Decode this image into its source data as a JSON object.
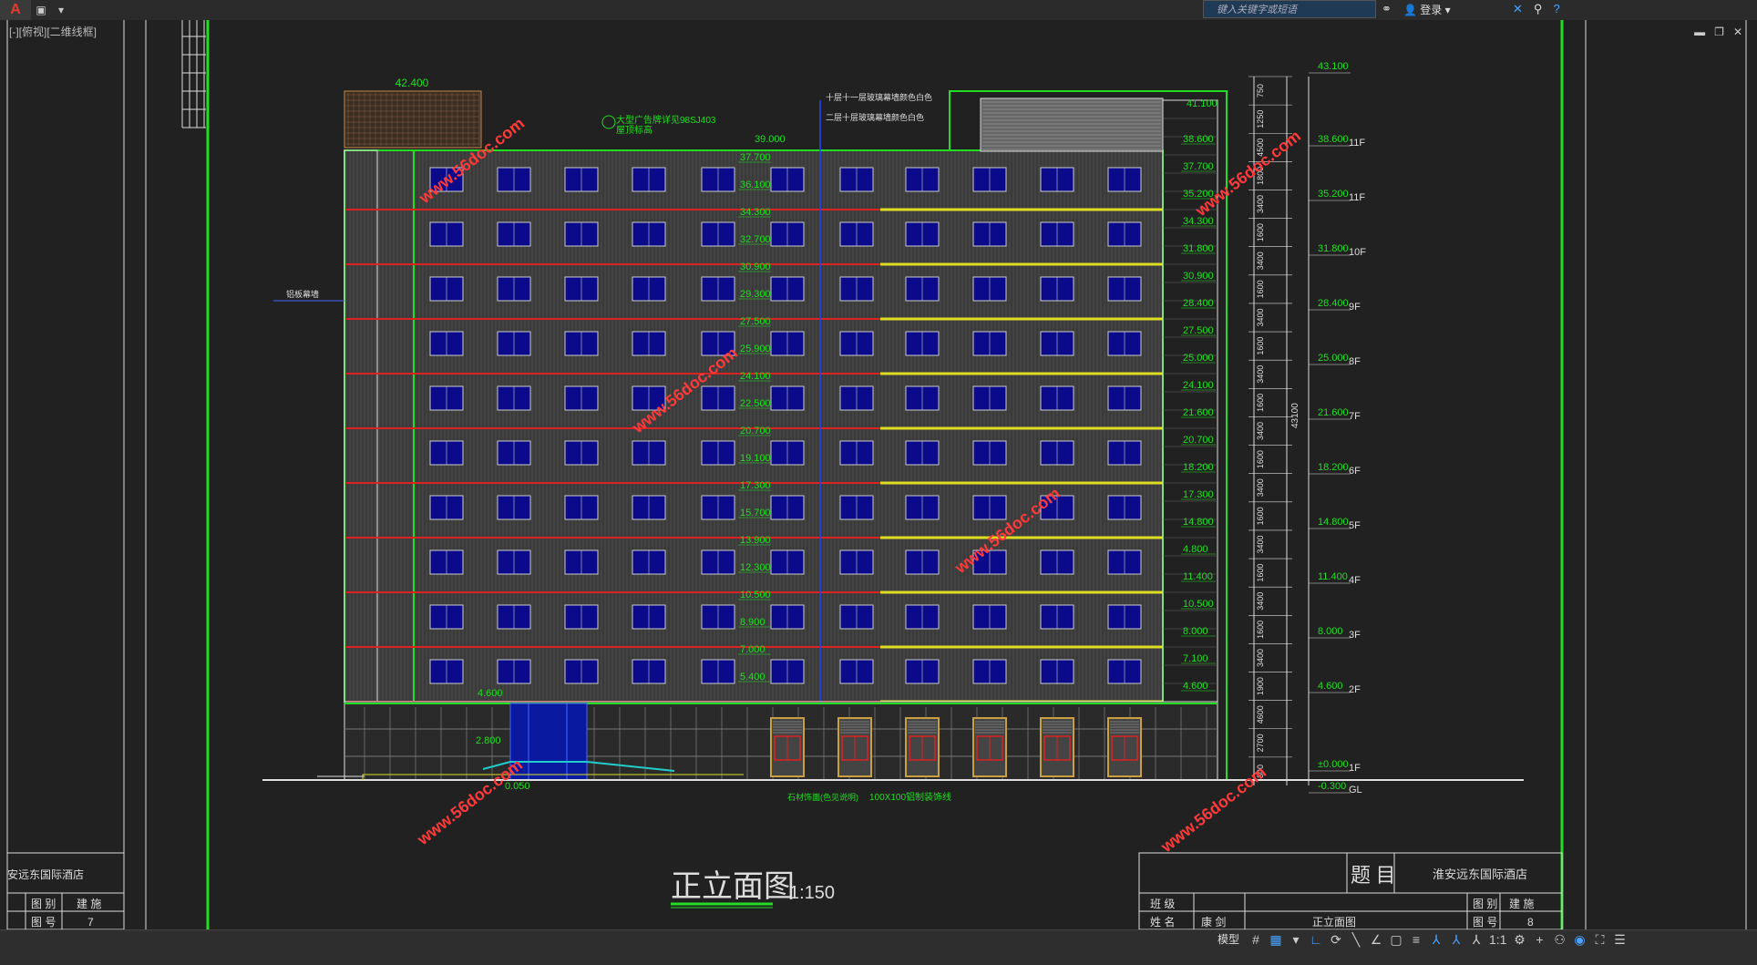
{
  "window": {
    "viewport_label": "[-][俯视][二维线框]",
    "search_placeholder": "键入关键字或短语",
    "login_label": "登录",
    "app_icon": "autocad-logo-icon"
  },
  "drawing": {
    "title": "正立面图",
    "scale": "1:150",
    "roof_elev": "42.400",
    "parapet_elev": "43.100",
    "top_slab": "41.100",
    "mid_elev": "39.000",
    "upper_note": "大型广告牌详见98SJ403",
    "upper_note2": "屋顶标高",
    "note_top1": "十层十一层玻璃幕墙颜色白色",
    "note_top2": "二层十层玻璃幕墙颜色白色",
    "note_left": "铝板幕墙",
    "left_elevs": [
      "37.700",
      "36.100",
      "34.300",
      "32.700",
      "30.900",
      "29.300",
      "27.500",
      "25.900",
      "24.100",
      "22.500",
      "20.700",
      "19.100",
      "17.300",
      "15.700",
      "13.900",
      "12.300",
      "10.500",
      "8.900",
      "7.000",
      "5.400"
    ],
    "right_elevs": [
      "38.600",
      "37.700",
      "35.200",
      "34.300",
      "31.800",
      "30.900",
      "28.400",
      "27.500",
      "25.000",
      "24.100",
      "21.600",
      "20.700",
      "18.200",
      "17.300",
      "14.800",
      "4.800",
      "11.400",
      "10.500",
      "8.000",
      "7.100",
      "4.600"
    ],
    "level_marks": [
      {
        "elev": "43.100",
        "floor": ""
      },
      {
        "elev": "38.600",
        "floor": "11F"
      },
      {
        "elev": "35.200",
        "floor": "11F"
      },
      {
        "elev": "31.800",
        "floor": "10F"
      },
      {
        "elev": "28.400",
        "floor": "9F"
      },
      {
        "elev": "25.000",
        "floor": "8F"
      },
      {
        "elev": "21.600",
        "floor": "7F"
      },
      {
        "elev": "18.200",
        "floor": "6F"
      },
      {
        "elev": "14.800",
        "floor": "5F"
      },
      {
        "elev": "11.400",
        "floor": "4F"
      },
      {
        "elev": "8.000",
        "floor": "3F"
      },
      {
        "elev": "4.600",
        "floor": "2F"
      },
      {
        "elev": "±0.000",
        "floor": "1F"
      },
      {
        "elev": "-0.300",
        "floor": "GL"
      }
    ],
    "dims_inner": [
      "750",
      "1250",
      "4500",
      "1800",
      "3400",
      "1600",
      "3400",
      "1600",
      "3400",
      "1600",
      "3400",
      "1600",
      "3400",
      "1600",
      "3400",
      "1600",
      "3400",
      "1600",
      "3400",
      "1600",
      "3400",
      "1900",
      "4600",
      "2700",
      "300"
    ],
    "dim_total": "43100",
    "ground_left1": "4.600",
    "ground_left2": "2.800",
    "ground_left3": "0.050",
    "bottom_note1": "石材饰面(色见说明)",
    "bottom_note2": "100X100铝制装饰线",
    "watermark": "www.56doc.com"
  },
  "title_block_right": {
    "heading": "题 目",
    "project": "淮安远东国际酒店",
    "row1_a": "班 级",
    "row2_a": "姓 名",
    "row2_b": "康 剑",
    "drawing_name": "正立面图",
    "cat_label": "图 别",
    "cat_value": "建 施",
    "no_label": "图 号",
    "no_value": "8"
  },
  "title_block_left": {
    "project": "安远东国际酒店",
    "cat_label": "图 别",
    "cat_value": "建 施",
    "no_label": "图 号",
    "no_value": "7"
  },
  "statusbar": {
    "model_label": "模型",
    "scale_label": "1:1"
  }
}
